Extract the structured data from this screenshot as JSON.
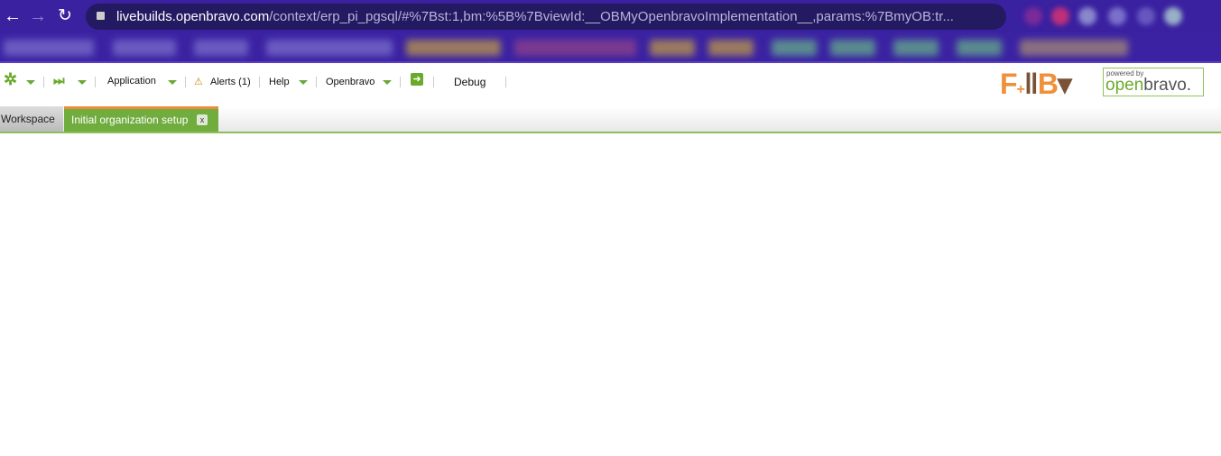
{
  "browser": {
    "url_host": "livebuilds.openbravo.com",
    "url_path": "/context/erp_pi_pgsql/#%7Bst:1,bm:%5B%7BviewId:__OBMyOpenbravoImplementation__,params:%7BmyOB:tr..."
  },
  "toolbar": {
    "application": "Application",
    "alerts": "Alerts (1)",
    "help": "Help",
    "openbravo": "Openbravo",
    "debug": "Debug"
  },
  "tabs": [
    {
      "label": "Workspace"
    },
    {
      "label": "Initial organization setup",
      "close": "x"
    }
  ],
  "logos": {
    "fnb": "F+B",
    "powered": "powered by",
    "brand_a": "open",
    "brand_b": "bravo."
  },
  "colors": {
    "chrome": "#3a21a0",
    "accent": "#70ac3e",
    "tab_top": "#f08a3e"
  }
}
